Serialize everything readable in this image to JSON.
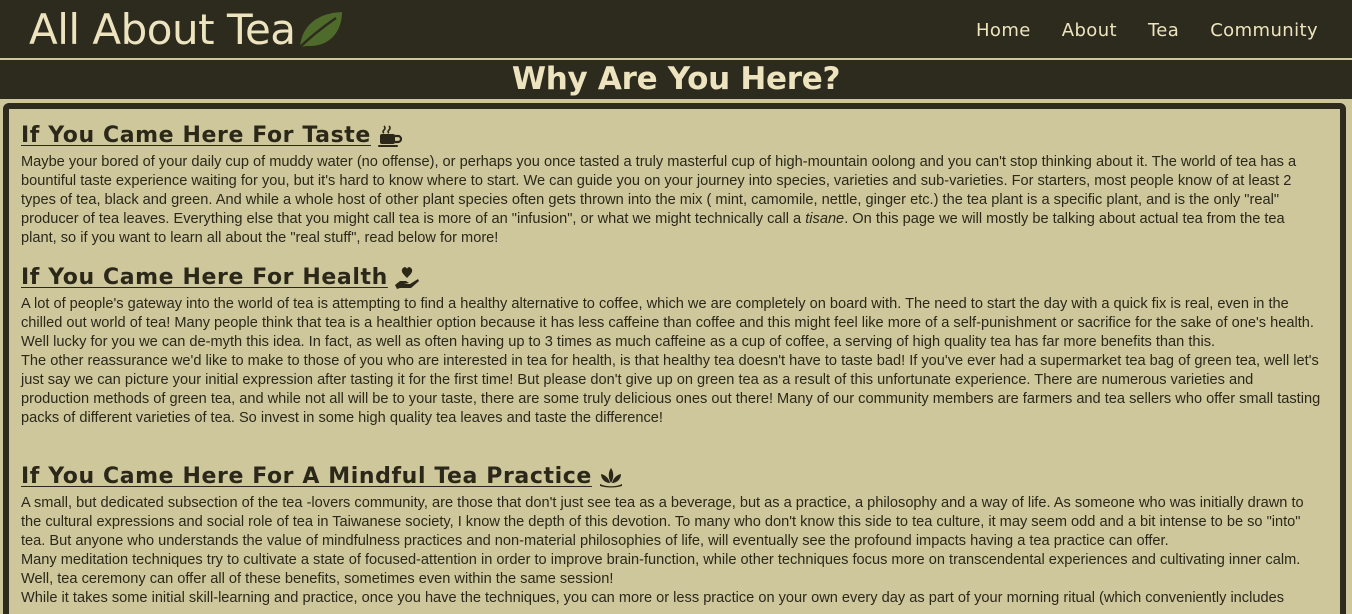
{
  "site": {
    "brand": "All About Tea",
    "nav": [
      "Home",
      "About",
      "Tea",
      "Community"
    ]
  },
  "hero": {
    "title": "Why Are You Here?"
  },
  "sections": [
    {
      "title": "If You Came Here For Taste",
      "icon": "coffee-cup-icon",
      "paragraphs": [
        "Maybe your bored of your daily cup of muddy water (no offense), or perhaps you once tasted a truly masterful cup of high-mountain oolong and you can't stop thinking about it. The world of tea has a bountiful taste experience waiting for you, but it's hard to know where to start. We can guide you on your journey into species, varieties and sub-varieties. For starters, most people know of at least 2 types of tea, black and green. And while a whole host of other plant species often gets thrown into the mix ( mint, camomile, nettle, ginger etc.) the tea plant is a specific plant, and is the only \"real\" producer of tea leaves. Everything else that you might call tea is more of an \"infusion\", or what we might technically call a "
      ],
      "italic": "tisane",
      "after_italic": ". On this page we will mostly be talking about actual tea from the tea plant, so if you want to learn all about the \"real stuff\", read below for more!"
    },
    {
      "title": "If You Came Here For Health",
      "icon": "hand-holding-heart-icon",
      "paragraphs": [
        "A lot of people's gateway into the world of tea is attempting to find a healthy alternative to coffee, which we are completely on board with. The need to start the day with a quick fix is real, even in the chilled out world of tea! Many people think that tea is a healthier option because it has less caffeine than coffee and this might feel like more of a self-punishment or sacrifice for the sake of one's health. Well lucky for you we can de-myth this idea. In fact, as well as often having up to 3 times as much caffeine as a cup of coffee, a serving of high quality tea has far more benefits than this.",
        "The other reassurance we'd like to make to those of you who are interested in tea for health, is that healthy tea doesn't have to taste bad! If you've ever had a supermarket tea bag of green tea, well let's just say we can picture your initial expression after tasting it for the first time! But please don't give up on green tea as a result of this unfortunate experience. There are numerous varieties and production methods of green tea, and while not all will be to your taste, there are some truly delicious ones out there! Many of our community members are farmers and tea sellers who offer small tasting packs of different varieties of tea. So invest in some high quality tea leaves and taste the difference!"
      ]
    },
    {
      "title": "If You Came Here For A Mindful Tea Practice",
      "icon": "lotus-icon",
      "paragraphs": [
        "A small, but dedicated subsection of the tea -lovers community, are those that don't just see tea as a beverage, but as a practice, a philosophy and a way of life. As someone who was initially drawn to the cultural expressions and social role of tea in Taiwanese society, I know the depth of this devotion. To many who don't know this side to tea culture, it may seem odd and a bit intense to be so \"into\" tea. But anyone who understands the value of mindfulness practices and non-material philosophies of life, will eventually see the profound impacts having a tea practice can offer.",
        "Many meditation techniques try to cultivate a state of focused-attention in order to improve brain-function, while other techniques focus more on transcendental experiences and cultivating inner calm. Well, tea ceremony can offer all of these benefits, sometimes even within the same session!",
        "While it takes some initial skill-learning and practice, once you have the techniques, you can more or less practice on your own every day as part of your morning ritual (which conveniently includes"
      ]
    }
  ],
  "colors": {
    "header_bg": "#2d2b1d",
    "page_bg": "#cfc79c",
    "header_text": "#ede4bf",
    "leaf_green": "#4e6b2c"
  }
}
